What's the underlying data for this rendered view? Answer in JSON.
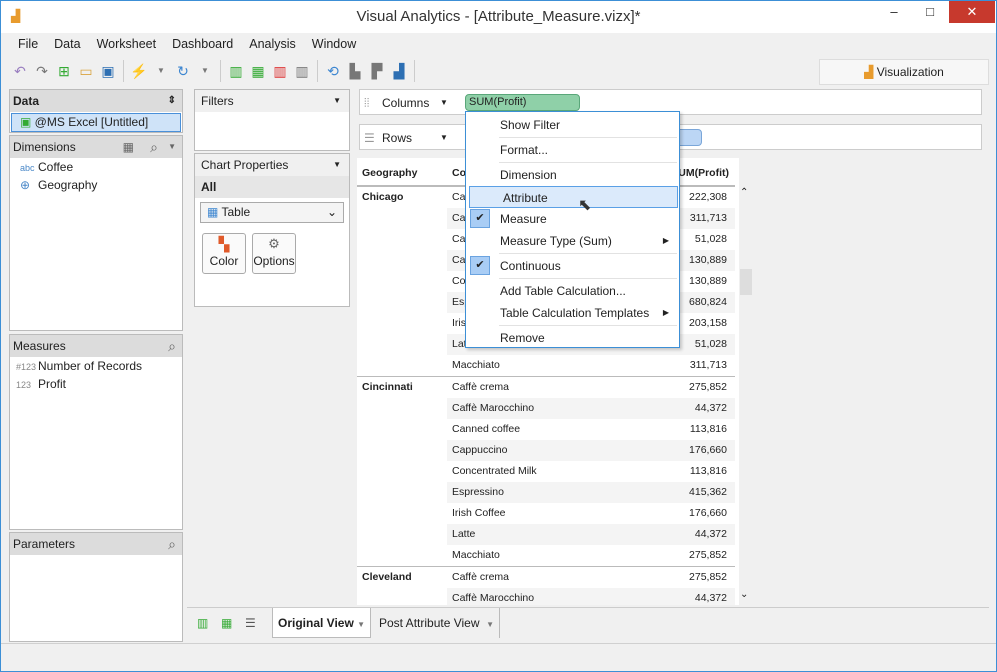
{
  "window": {
    "title": "Visual Analytics - [Attribute_Measure.vizx]*",
    "minimize": "–",
    "maximize": "□",
    "close": "✕"
  },
  "menubar": [
    "File",
    "Data",
    "Worksheet",
    "Dashboard",
    "Analysis",
    "Window"
  ],
  "toolbar_icons": [
    "undo-icon",
    "redo-icon",
    "new-icon",
    "open-icon",
    "save-icon",
    "connect-icon",
    "refresh-icon",
    "add-chart-icon",
    "add-table-icon",
    "delete-chart-icon",
    "clear-chart-icon",
    "swap-icon",
    "sort-asc-icon",
    "sort-desc-icon",
    "show-me-icon"
  ],
  "vis_tab": "Visualization",
  "data_panel": {
    "title": "Data",
    "source": "@MS Excel [Untitled]"
  },
  "dimensions": {
    "title": "Dimensions",
    "items": [
      {
        "icon": "abc",
        "label": "Coffee"
      },
      {
        "icon": "globe",
        "label": "Geography"
      }
    ]
  },
  "measures": {
    "title": "Measures",
    "items": [
      {
        "icon": "#123",
        "label": "Number of Records"
      },
      {
        "icon": "123",
        "label": "Profit"
      }
    ]
  },
  "parameters": {
    "title": "Parameters"
  },
  "filters": {
    "title": "Filters"
  },
  "chart_properties": {
    "title": "Chart Properties",
    "all": "All",
    "chart_type": "Table",
    "color": "Color",
    "options": "Options"
  },
  "shelves": {
    "columns": "Columns",
    "rows": "Rows",
    "columns_pill": "SUM(Profit)"
  },
  "table": {
    "headers": [
      "Geography",
      "Coffee",
      "SUM(Profit)"
    ],
    "groups": [
      {
        "geo": "Chicago",
        "rows": [
          [
            "Caffè crema",
            "222,308"
          ],
          [
            "Caffè Marocchino",
            "311,713"
          ],
          [
            "Canned coffee",
            "51,028"
          ],
          [
            "Cappuccino",
            "130,889"
          ],
          [
            "Concentrated Milk",
            "130,889"
          ],
          [
            "Espressino",
            "680,824"
          ],
          [
            "Irish Coffee",
            "203,158"
          ],
          [
            "Latte",
            "51,028"
          ],
          [
            "Macchiato",
            "311,713"
          ]
        ]
      },
      {
        "geo": "Cincinnati",
        "rows": [
          [
            "Caffè crema",
            "275,852"
          ],
          [
            "Caffè Marocchino",
            "44,372"
          ],
          [
            "Canned coffee",
            "113,816"
          ],
          [
            "Cappuccino",
            "176,660"
          ],
          [
            "Concentrated Milk",
            "113,816"
          ],
          [
            "Espressino",
            "415,362"
          ],
          [
            "Irish Coffee",
            "176,660"
          ],
          [
            "Latte",
            "44,372"
          ],
          [
            "Macchiato",
            "275,852"
          ]
        ]
      },
      {
        "geo": "Cleveland",
        "rows": [
          [
            "Caffè crema",
            "275,852"
          ],
          [
            "Caffè Marocchino",
            "44,372"
          ]
        ]
      }
    ]
  },
  "context_menu": [
    {
      "label": "Show Filter"
    },
    {
      "sep": true
    },
    {
      "label": "Format..."
    },
    {
      "sep": true
    },
    {
      "label": "Dimension"
    },
    {
      "label": "Attribute",
      "highlight": true
    },
    {
      "label": "Measure",
      "checked": true
    },
    {
      "label": "Measure Type (Sum)",
      "submenu": true
    },
    {
      "sep": true
    },
    {
      "label": "Continuous",
      "checked": true
    },
    {
      "sep": true
    },
    {
      "label": "Add Table Calculation..."
    },
    {
      "label": "Table Calculation Templates",
      "submenu": true
    },
    {
      "sep": true
    },
    {
      "label": "Remove"
    }
  ],
  "sheet_tabs": [
    {
      "label": "Original View",
      "active": true
    },
    {
      "label": "Post Attribute View",
      "active": false
    }
  ],
  "colors": {
    "accent": "#3c8fd6",
    "pill_green": "#8fd0a8",
    "close": "#c7392d"
  }
}
